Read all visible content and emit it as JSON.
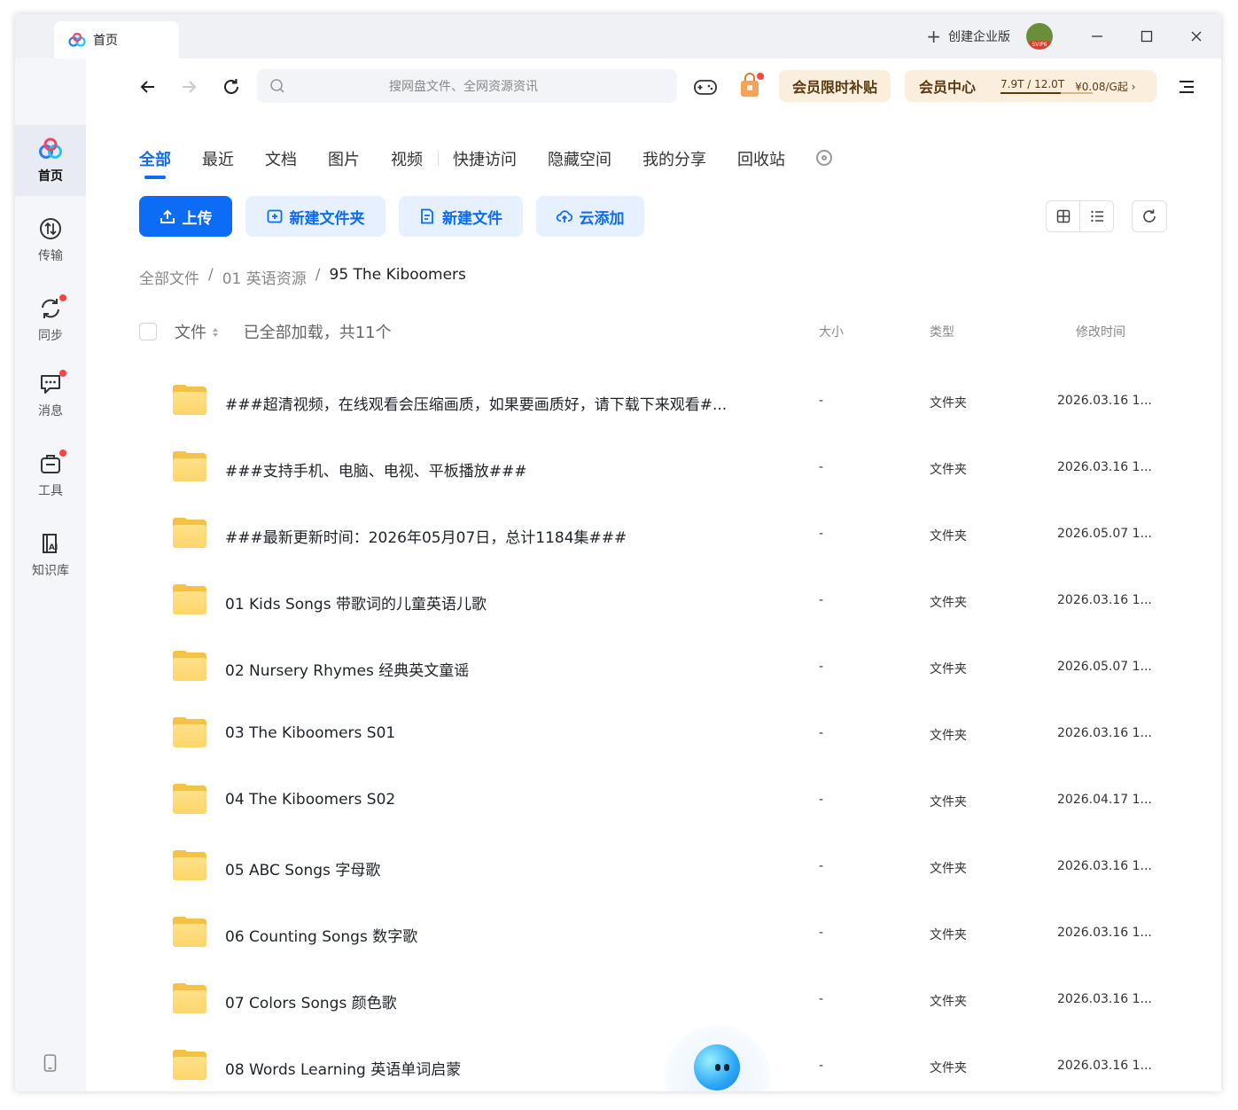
{
  "window": {
    "tab_title": "首页",
    "create_enterprise": "创建企业版",
    "avatar_badge": "SVIP6"
  },
  "sidebar": {
    "items": [
      {
        "label": "首页",
        "icon": "home-logo-icon",
        "active": true
      },
      {
        "label": "传输",
        "icon": "transfer-icon",
        "badge": false
      },
      {
        "label": "同步",
        "icon": "sync-icon",
        "badge": true
      },
      {
        "label": "消息",
        "icon": "message-icon",
        "badge": true
      },
      {
        "label": "工具",
        "icon": "toolbox-icon",
        "badge": true
      },
      {
        "label": "知识库",
        "icon": "knowledge-base-icon",
        "badge": false
      }
    ]
  },
  "search": {
    "placeholder": "搜网盘文件、全网资源资讯"
  },
  "promo": {
    "limited": "会员限时补贴",
    "vip_center": "会员中心",
    "quota": "7.9T / 12.0T",
    "quota_used_fraction": 0.658,
    "price": "¥0.08/G起 ›"
  },
  "tabs": [
    "全部",
    "最近",
    "文档",
    "图片",
    "视频",
    "快捷访问",
    "隐藏空间",
    "我的分享",
    "回收站"
  ],
  "actions": {
    "upload": "上传",
    "new_folder": "新建文件夹",
    "new_file": "新建文件",
    "cloud_add": "云添加"
  },
  "breadcrumb": {
    "root": "全部文件",
    "sep": "/",
    "level1": "01 英语资源",
    "current": "95 The Kiboomers"
  },
  "list": {
    "col_file": "文件",
    "count_text": "已全部加载，共11个",
    "col_size": "大小",
    "col_type": "类型",
    "col_time": "修改时间",
    "rows": [
      {
        "name": "###超清视频，在线观看会压缩画质，如果要画质好，请下载下来观看#...",
        "size": "-",
        "type": "文件夹",
        "time": "2026.03.16 1..."
      },
      {
        "name": "###支持手机、电脑、电视、平板播放###",
        "size": "-",
        "type": "文件夹",
        "time": "2026.03.16 1..."
      },
      {
        "name": "###最新更新时间：2026年05月07日，总计1184集###",
        "size": "-",
        "type": "文件夹",
        "time": "2026.05.07 1..."
      },
      {
        "name": "01 Kids Songs 带歌词的儿童英语儿歌",
        "size": "-",
        "type": "文件夹",
        "time": "2026.03.16 1..."
      },
      {
        "name": "02 Nursery Rhymes 经典英文童谣",
        "size": "-",
        "type": "文件夹",
        "time": "2026.05.07 1..."
      },
      {
        "name": "03 The Kiboomers S01",
        "size": "-",
        "type": "文件夹",
        "time": "2026.03.16 1..."
      },
      {
        "name": "04 The Kiboomers S02",
        "size": "-",
        "type": "文件夹",
        "time": "2026.04.17 1..."
      },
      {
        "name": "05 ABC Songs 字母歌",
        "size": "-",
        "type": "文件夹",
        "time": "2026.03.16 1..."
      },
      {
        "name": "06 Counting Songs 数字歌",
        "size": "-",
        "type": "文件夹",
        "time": "2026.03.16 1..."
      },
      {
        "name": "07 Colors Songs 颜色歌",
        "size": "-",
        "type": "文件夹",
        "time": "2026.03.16 1..."
      },
      {
        "name": "08 Words Learning 英语单词启蒙",
        "size": "-",
        "type": "文件夹",
        "time": "2026.03.16 1..."
      }
    ]
  },
  "colors": {
    "accent": "#0d6cf5",
    "promo_bg": "#fbeedd",
    "folder": "#f5c246",
    "badge": "#ff4444"
  }
}
